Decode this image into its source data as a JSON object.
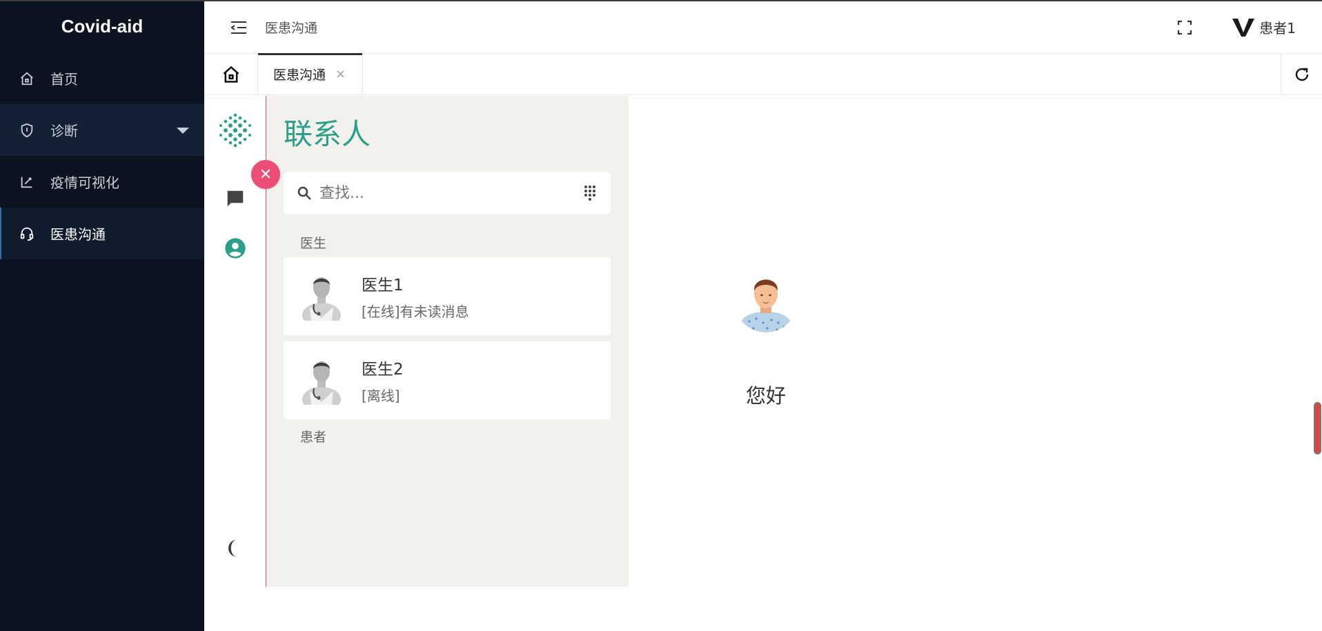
{
  "app": {
    "brand": "Covid-aid"
  },
  "sidebar": {
    "items": [
      {
        "label": "首页",
        "icon": "home-icon"
      },
      {
        "label": "诊断",
        "icon": "shield-icon"
      },
      {
        "label": "疫情可视化",
        "icon": "chart-edit-icon"
      },
      {
        "label": "医患沟通",
        "icon": "headset-icon"
      }
    ]
  },
  "header": {
    "breadcrumb": "医患沟通",
    "user_name": "患者1"
  },
  "tabs": [
    {
      "label": "医患沟通",
      "close": "×"
    }
  ],
  "contacts": {
    "title": "联系人",
    "search_placeholder": "查找...",
    "groups": [
      {
        "label": "医生",
        "items": [
          {
            "name": "医生1",
            "status": "[在线]有未读消息"
          },
          {
            "name": "医生2",
            "status": "[离线]"
          }
        ]
      },
      {
        "label": "患者",
        "items": []
      }
    ]
  },
  "conversation": {
    "greeting": "您好"
  },
  "close_label": "✕",
  "colors": {
    "accent": "#2aa089",
    "danger": "#eb4d77",
    "sidebar_bg": "#0b1220"
  }
}
